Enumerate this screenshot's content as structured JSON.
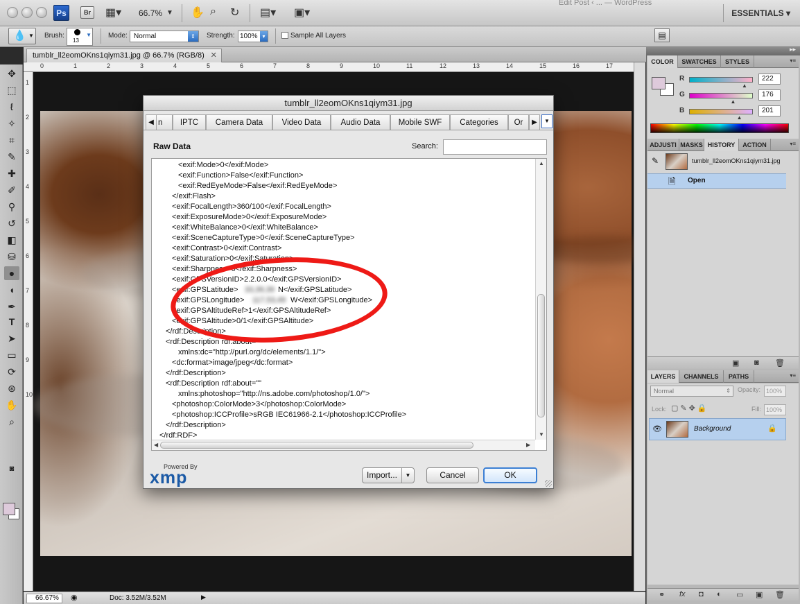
{
  "app": {
    "ps_badge": "Ps",
    "br_badge": "Br",
    "zoom": "66.7%",
    "workspace": "ESSENTIALS",
    "background_window_title": "Edit Post ‹ ... — WordPress"
  },
  "options": {
    "brush_label": "Brush:",
    "brush_size": "13",
    "mode_label": "Mode:",
    "mode_value": "Normal",
    "strength_label": "Strength:",
    "strength_value": "100%",
    "sample_all_layers": "Sample All Layers"
  },
  "document": {
    "tab_title": "tumblr_ll2eomOKns1qiym31.jpg @ 66.7% (RGB/8)",
    "close_glyph": "✕",
    "ruler_ticks": [
      "0",
      "1",
      "2",
      "3",
      "4",
      "5",
      "6",
      "7",
      "8",
      "9",
      "10",
      "11",
      "12",
      "13",
      "14",
      "15",
      "16",
      "17"
    ],
    "ruler_v_ticks": [
      "1",
      "2",
      "3",
      "4",
      "5",
      "6",
      "7",
      "8",
      "9",
      "10"
    ]
  },
  "status": {
    "zoom": "66.67%",
    "doc": "Doc: 3.52M/3.52M"
  },
  "panels": {
    "color_tabs": [
      "COLOR",
      "SWATCHES",
      "STYLES"
    ],
    "sliders": [
      {
        "label": "R",
        "value": "222",
        "fraction": 0.87,
        "gradient": "linear-gradient(90deg,#00b0c9,#ffb0c9)"
      },
      {
        "label": "G",
        "value": "176",
        "fraction": 0.69,
        "gradient": "linear-gradient(90deg,#de00c9,#deffc9)"
      },
      {
        "label": "B",
        "value": "201",
        "fraction": 0.79,
        "gradient": "linear-gradient(90deg,#deb000,#deb0ff)"
      }
    ],
    "history_tabs": [
      "ADJUSTI",
      "MASKS",
      "HISTORY",
      "ACTION"
    ],
    "history_snapshot": "tumblr_ll2eomOKns1qiym31.jpg",
    "history_step": "Open",
    "layers_tabs": [
      "LAYERS",
      "CHANNELS",
      "PATHS"
    ],
    "blend_mode": "Normal",
    "opacity_label": "Opacity:",
    "opacity_value": "100%",
    "lock_label": "Lock:",
    "fill_label": "Fill:",
    "fill_value": "100%",
    "layer_name": "Background"
  },
  "dialog": {
    "title": "tumblr_ll2eomOKns1qiym31.jpg",
    "tabs": [
      "n",
      "IPTC",
      "Camera Data",
      "Video Data",
      "Audio Data",
      "Mobile SWF",
      "Categories",
      "Or"
    ],
    "heading": "Raw Data",
    "search_label": "Search:",
    "search_value": "",
    "lines": [
      "<exif:Mode>0</exif:Mode>",
      "<exif:Function>False</exif:Function>",
      "<exif:RedEyeMode>False</exif:RedEyeMode>",
      "</exif:Flash>",
      "<exif:FocalLength>360/100</exif:FocalLength>",
      "<exif:ExposureMode>0</exif:ExposureMode>",
      "<exif:WhiteBalance>0</exif:WhiteBalance>",
      "<exif:SceneCaptureType>0</exif:SceneCaptureType>",
      "<exif:Contrast>0</exif:Contrast>",
      "<exif:Saturation>0</exif:Saturation>",
      "<exif:Sharpness>0</exif:Sharpness>",
      "<exif:GPSVersionID>2.2.0.0</exif:GPSVersionID>",
      "<exif:GPSLatitude>",
      "N</exif:GPSLatitude>",
      "<exif:GPSLongitude>",
      "W</exif:GPSLongitude>",
      "<exif:GPSAltitudeRef>1</exif:GPSAltitudeRef>",
      "<exif:GPSAltitude>0/1</exif:GPSAltitude>",
      "</rdf:Description>",
      "<rdf:Description rdf:about=\"\"",
      "xmlns:dc=\"http://purl.org/dc/elements/1.1/\">",
      "<dc:format>image/jpeg</dc:format>",
      "</rdf:Description>",
      "<rdf:Description rdf:about=\"\"",
      "xmlns:photoshop=\"http://ns.adobe.com/photoshop/1.0/\">",
      "<photoshop:ColorMode>3</photoshop:ColorMode>",
      "<photoshop:ICCProfile>sRGB IEC61966-2.1</photoshop:ICCProfile>",
      "</rdf:Description>",
      "</rdf:RDF>"
    ],
    "blurred_latitude": "33,39,39",
    "blurred_longitude": "117,53,49",
    "powered_by": "Powered By",
    "xmp_logo": "xmp",
    "import_label": "Import...",
    "cancel_label": "Cancel",
    "ok_label": "OK",
    "annotation_color": "#ee1a16"
  }
}
